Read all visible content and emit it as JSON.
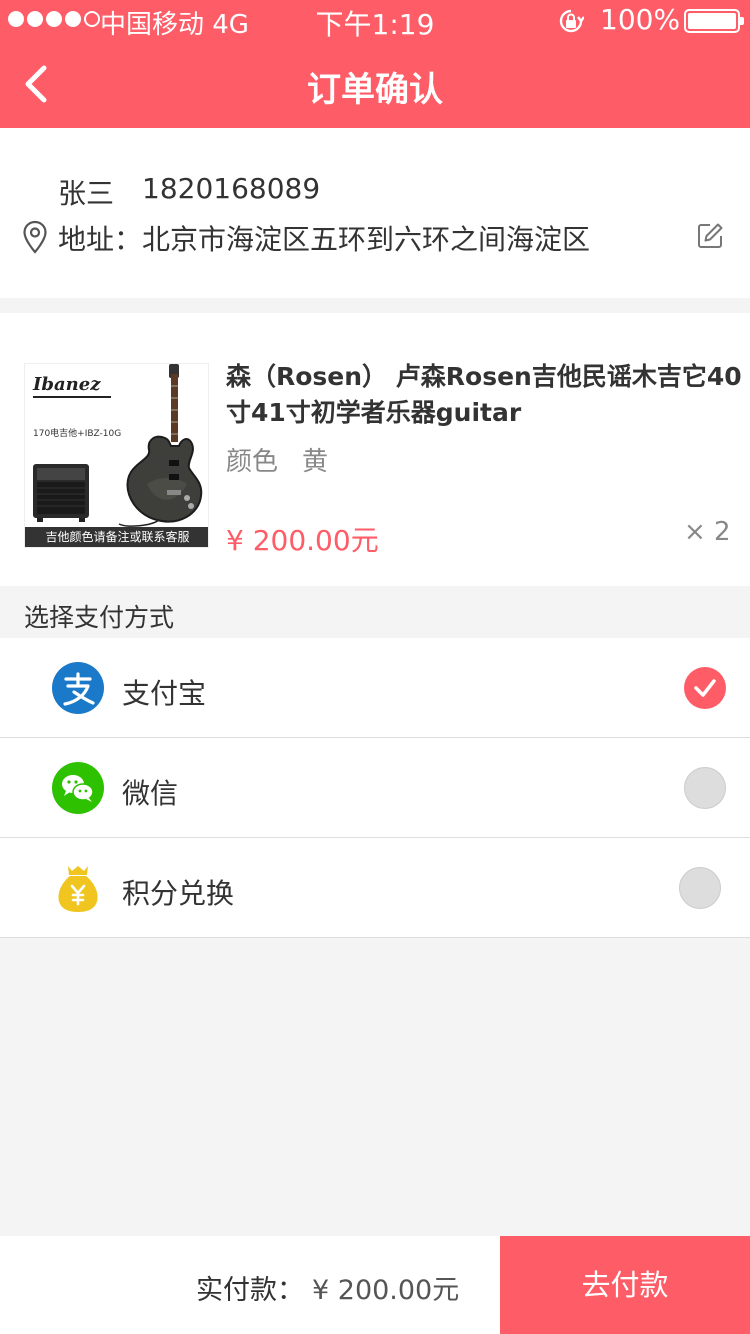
{
  "status_bar": {
    "carrier": "中国移动  4G",
    "time": "下午1:19",
    "battery": "100%",
    "signal_icon": "signal-dots-icon",
    "lock_icon": "orientation-lock-icon"
  },
  "nav": {
    "title": "订单确认",
    "back_icon": "chevron-left-icon"
  },
  "address": {
    "name": "张三",
    "phone": "1820168089",
    "label": "地址：",
    "value": "北京市海淀区五环到六环之间海淀区",
    "pin_icon": "location-pin-icon",
    "edit_icon": "edit-icon"
  },
  "product": {
    "image": {
      "brand": "Ibanez",
      "model": "170电吉他+IBZ-10G",
      "caption": "吉他颜色请备注或联系客服"
    },
    "name": "森（Rosen） 卢森Rosen吉他民谣木吉它40寸41寸初学者乐器guitar",
    "spec_label": "颜色",
    "spec_value": "黄",
    "price": "¥  200.00元",
    "quantity": "× 2"
  },
  "payment": {
    "section_title": "选择支付方式",
    "methods": [
      {
        "label": "支付宝",
        "icon": "alipay-icon",
        "selected": true
      },
      {
        "label": "微信",
        "icon": "wechat-icon",
        "selected": false
      },
      {
        "label": "积分兑换",
        "icon": "money-bag-icon",
        "selected": false
      }
    ]
  },
  "footer": {
    "total_label": "实付款：",
    "total_amount": "¥ 200.00元",
    "pay_button": "去付款"
  },
  "colors": {
    "accent": "#fe5c67",
    "alipay": "#1a7ac9",
    "wechat": "#2dc100",
    "points": "#f0c520"
  }
}
